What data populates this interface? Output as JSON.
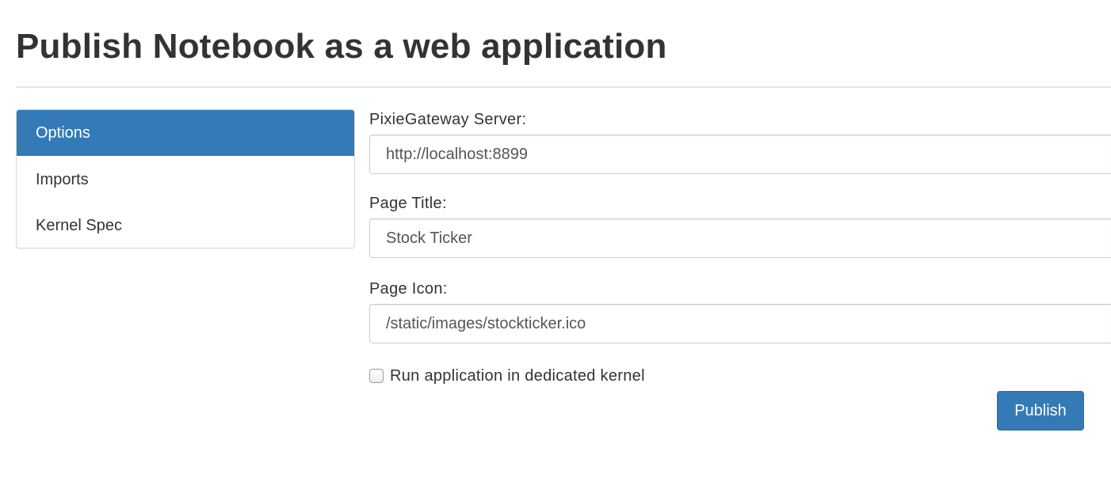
{
  "header": {
    "title": "Publish Notebook as a web application"
  },
  "sidebar": {
    "items": [
      {
        "label": "Options",
        "active": true
      },
      {
        "label": "Imports",
        "active": false
      },
      {
        "label": "Kernel Spec",
        "active": false
      }
    ]
  },
  "form": {
    "server": {
      "label": "PixieGateway Server:",
      "value": "http://localhost:8899"
    },
    "page_title": {
      "label": "Page Title:",
      "value": "Stock Ticker"
    },
    "page_icon": {
      "label": "Page Icon:",
      "value": "/static/images/stockticker.ico"
    },
    "dedicated_kernel": {
      "label": "Run application in dedicated kernel",
      "checked": false
    },
    "publish_label": "Publish"
  },
  "colors": {
    "accent": "#337ab7",
    "text": "#333333",
    "border": "#cccccc"
  }
}
